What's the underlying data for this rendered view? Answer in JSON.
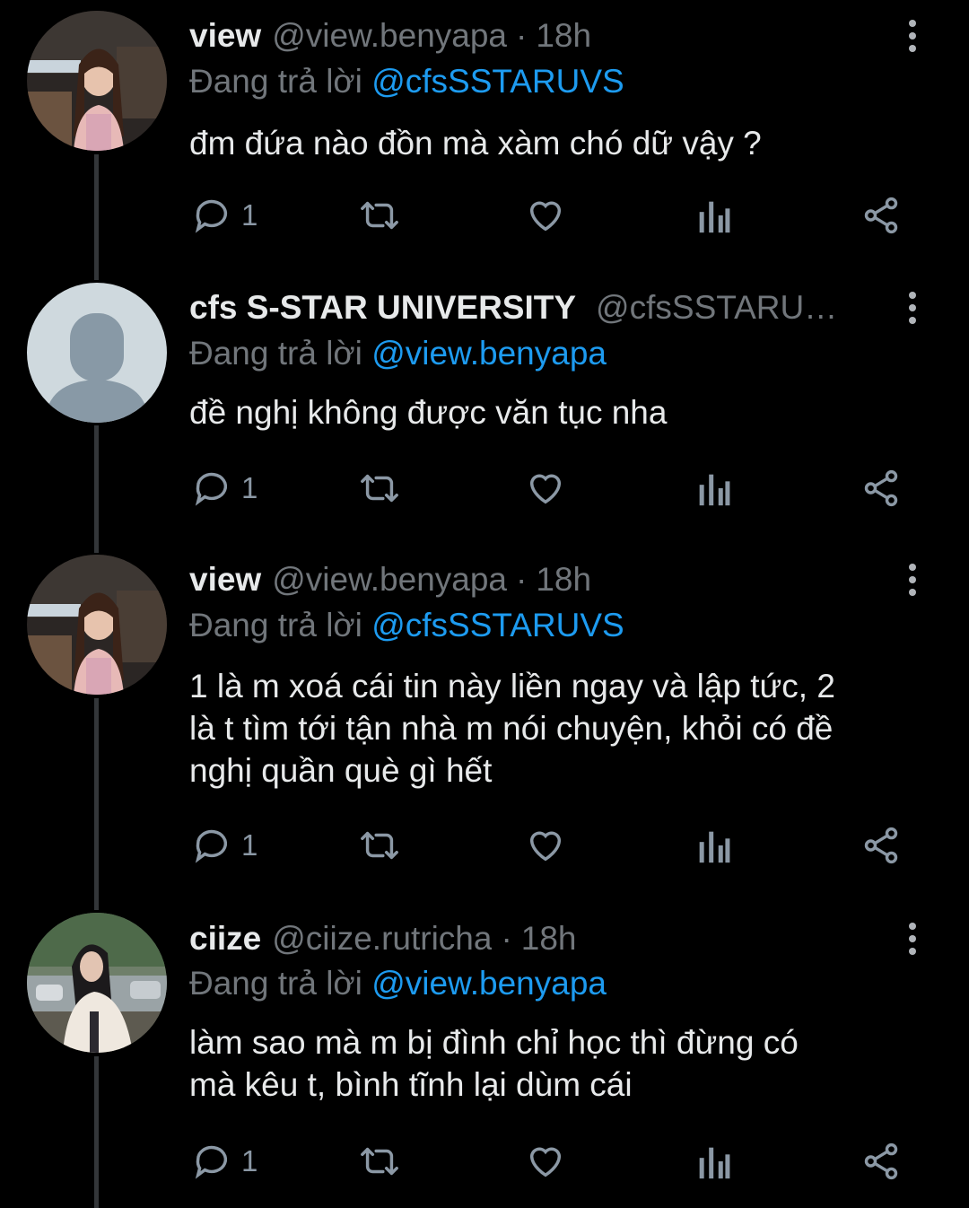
{
  "ui": {
    "reply_prefix": "Đang trả lời",
    "dot": "·",
    "accent_color": "#1d9bf0",
    "text_color": "#e7e9ea",
    "muted_color": "#71767b",
    "background": "#000000"
  },
  "tweets": [
    {
      "name": "view",
      "handle": "@view.benyapa",
      "time": "18h",
      "reply_to": "@cfsSSTARUVS",
      "text": "đm đứa nào đồn mà xàm chó dữ vậy ?",
      "reply_count": "1",
      "avatar": "avatar-photo-woman"
    },
    {
      "name": "cfs S-STAR UNIVERSITY",
      "handle": "@cfsSSTARU…",
      "time": "",
      "reply_to": "@view.benyapa",
      "text": "đề nghị không được văn tục nha",
      "reply_count": "1",
      "avatar": "default-avatar-icon"
    },
    {
      "name": "view",
      "handle": "@view.benyapa",
      "time": "18h",
      "reply_to": "@cfsSSTARUVS",
      "text_lines": [
        "1 là m xoá cái tin này liền ngay và lập tức, 2",
        "là t tìm tới tận nhà m nói chuyện, khỏi có đề",
        "nghị quần què gì hết"
      ],
      "reply_count": "1",
      "avatar": "avatar-photo-woman"
    },
    {
      "name": "ciize",
      "handle": "@ciize.rutricha",
      "time": "18h",
      "reply_to": "@view.benyapa",
      "text_lines": [
        "làm sao mà m bị đình chỉ học thì đừng có",
        "mà kêu t, bình tĩnh lại dùm cái"
      ],
      "reply_count": "1",
      "avatar": "avatar-photo-woman-outdoor"
    }
  ]
}
